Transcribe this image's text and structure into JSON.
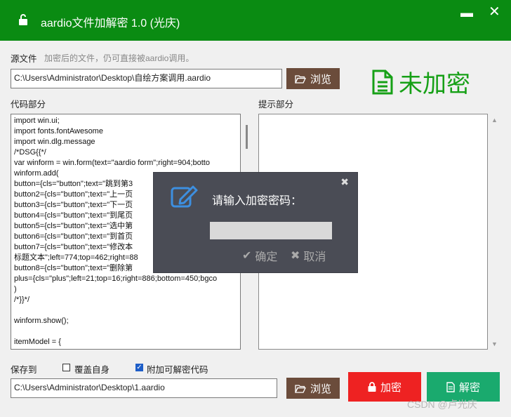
{
  "window": {
    "title": "aardio文件加解密 1.0 (光庆)",
    "minimize_glyph": "▬",
    "close_glyph": "✕"
  },
  "source": {
    "label": "源文件",
    "hint": "加密后的文件，仍可直接被aardio调用。",
    "path": "C:\\Users\\Administrator\\Desktop\\自绘方案调用.aardio",
    "browse_label": "浏览"
  },
  "status": {
    "text": "未加密",
    "icon": "file-text-icon",
    "color": "#16a016"
  },
  "code": {
    "label": "代码部分",
    "content": "import win.ui;\nimport fonts.fontAwesome\nimport win.dlg.message\n/*DSG{{*/\nvar winform = win.form(text=\"aardio form\";right=904;botto\nwinform.add(\nbutton={cls=\"button\";text=\"跳到第3\nbutton2={cls=\"button\";text=\"上一页\nbutton3={cls=\"button\";text=\"下一页\nbutton4={cls=\"button\";text=\"到尾页\nbutton5={cls=\"button\";text=\"选中第\nbutton6={cls=\"button\";text=\"到首页\nbutton7={cls=\"button\";text=\"修改本\n标题文本\";left=774;top=462;right=88\nbutton8={cls=\"button\";text=\"删除第\nplus={cls=\"plus\";left=21;top=16;right=886;bottom=450;bgco\n)\n/*}}*/\n\nwinform.show();\n\nitemModel = {"
  },
  "hint_panel": {
    "label": "提示部分",
    "content": ""
  },
  "save": {
    "label": "保存到",
    "overwrite_label": "覆盖自身",
    "overwrite_checked": false,
    "attach_label": "附加可解密代码",
    "attach_checked": true,
    "path": "C:\\Users\\Administrator\\Desktop\\1.aardio",
    "browse_label": "浏览"
  },
  "actions": {
    "encrypt_label": "加密",
    "encrypt_color": "#ee2222",
    "decrypt_label": "解密",
    "decrypt_color": "#1aaa6e"
  },
  "dialog": {
    "prompt": "请输入加密密码：",
    "password_value": "",
    "confirm_label": "确定",
    "cancel_label": "取消",
    "close_glyph": "✖"
  },
  "watermark": "CSDN @卢光庆"
}
